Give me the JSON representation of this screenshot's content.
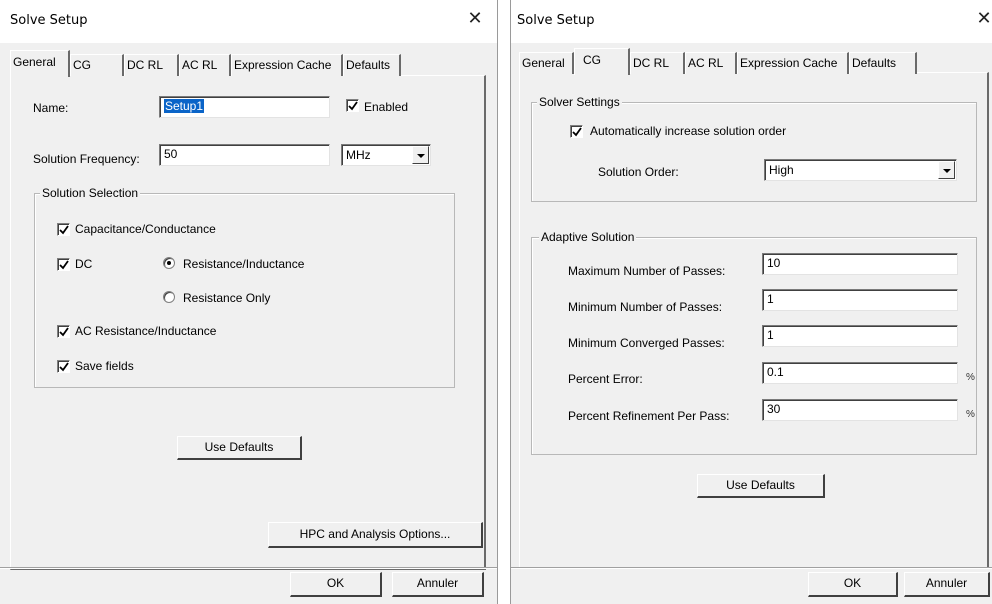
{
  "left_dialog": {
    "title": "Solve Setup",
    "tabs": [
      "General",
      "CG",
      "DC RL",
      "AC RL",
      "Expression Cache",
      "Defaults"
    ],
    "name_label": "Name:",
    "name_value": "Setup1",
    "enabled_label": "Enabled",
    "enabled_checked": true,
    "frequency_label": "Solution Frequency:",
    "frequency_value": "50",
    "frequency_unit": "MHz",
    "solution_selection": {
      "group_label": "Solution Selection",
      "capacitance_label": "Capacitance/Conductance",
      "capacitance_checked": true,
      "dc_label": "DC",
      "dc_checked": true,
      "radio_resistance_inductance": "Resistance/Inductance",
      "radio_resistance_only": "Resistance Only",
      "selected_radio": "Resistance/Inductance",
      "ac_label": "AC Resistance/Inductance",
      "ac_checked": true,
      "save_fields_label": "Save fields",
      "save_fields_checked": true
    },
    "use_defaults_label": "Use Defaults",
    "hpc_label": "HPC and Analysis Options...",
    "ok_label": "OK",
    "cancel_label": "Annuler"
  },
  "right_dialog": {
    "title": "Solve Setup",
    "tabs": [
      "General",
      "CG",
      "DC RL",
      "AC RL",
      "Expression Cache",
      "Defaults"
    ],
    "solver_settings": {
      "group_label": "Solver Settings",
      "auto_increase_label": "Automatically increase solution order",
      "auto_increase_checked": true,
      "order_label": "Solution Order:",
      "order_value": "High"
    },
    "adaptive_solution": {
      "group_label": "Adaptive Solution",
      "max_passes_label": "Maximum Number of Passes:",
      "max_passes_value": "10",
      "min_passes_label": "Minimum Number of Passes:",
      "min_passes_value": "1",
      "min_converged_label": "Minimum Converged Passes:",
      "min_converged_value": "1",
      "percent_error_label": "Percent Error:",
      "percent_error_value": "0.1",
      "percent_error_unit": "%",
      "refinement_label": "Percent Refinement Per Pass:",
      "refinement_value": "30",
      "refinement_unit": "%"
    },
    "use_defaults_label": "Use Defaults",
    "ok_label": "OK",
    "cancel_label": "Annuler"
  }
}
